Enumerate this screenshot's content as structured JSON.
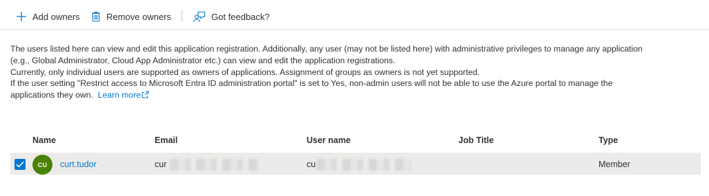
{
  "toolbar": {
    "add_owners": "Add owners",
    "remove_owners": "Remove owners",
    "feedback": "Got feedback?"
  },
  "info": {
    "line1": "The users listed here can view and edit this application registration. Additionally, any user (may not be listed here) with administrative privileges to manage any application",
    "line2": "(e.g., Global Administrator, Cloud App Administrator etc.) can view and edit the application registrations.",
    "line3": "Currently, only individual users are supported as owners of applications. Assignment of groups as owners is not yet supported.",
    "line4": "If the user setting \"Restrict access to Microsoft Entra ID administration portal\" is set to Yes, non-admin users will not be able to use the Azure portal to manage the",
    "line5": "applications they own.",
    "learn_more": "Learn more"
  },
  "table": {
    "columns": {
      "name": "Name",
      "email": "Email",
      "username": "User name",
      "job_title": "Job Title",
      "type": "Type"
    },
    "rows": [
      {
        "selected": true,
        "initials": "CU",
        "name": "curt.tudor",
        "email_visible": "cur",
        "username_visible": "cu",
        "job_title": "",
        "type": "Member"
      }
    ]
  },
  "colors": {
    "accent": "#0078d4",
    "avatar_bg": "#498205",
    "row_selected_bg": "#edebe9"
  },
  "icons": {
    "add": "plus-icon",
    "remove": "trash-icon",
    "feedback": "feedback-person-icon",
    "external": "external-link-icon",
    "check": "checkmark-icon"
  }
}
